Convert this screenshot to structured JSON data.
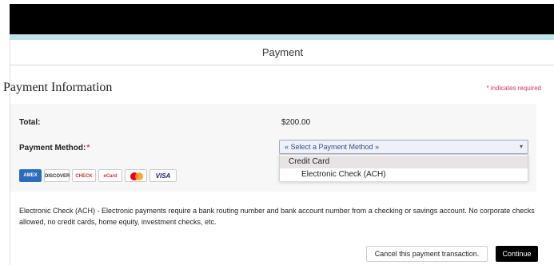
{
  "header": {
    "title": "Payment"
  },
  "section": {
    "title": "Payment Information",
    "required_note": "indicates required"
  },
  "form": {
    "total_label": "Total:",
    "total_value": "$200.00",
    "method_label": "Payment Method:",
    "method_required_mark": "*",
    "select_placeholder": "Select a Payment Method",
    "options": [
      "Credit Card",
      "Electronic Check (ACH)"
    ]
  },
  "logos": [
    "AMEX",
    "DISCOVER",
    "CHECK",
    "eCard",
    "MasterCard",
    "VISA"
  ],
  "description": "Electronic Check (ACH) - Electronic payments require a bank routing number and bank account number from a checking or savings account. No corporate checks allowed, no credit cards, home equity, investment checks, etc.",
  "actions": {
    "cancel_label": "Cancel this payment transaction.",
    "continue_label": "Continue"
  },
  "colors": {
    "accent_strip": "#bfe3ea",
    "required": "#d6336c",
    "continue_bg": "#000000"
  }
}
